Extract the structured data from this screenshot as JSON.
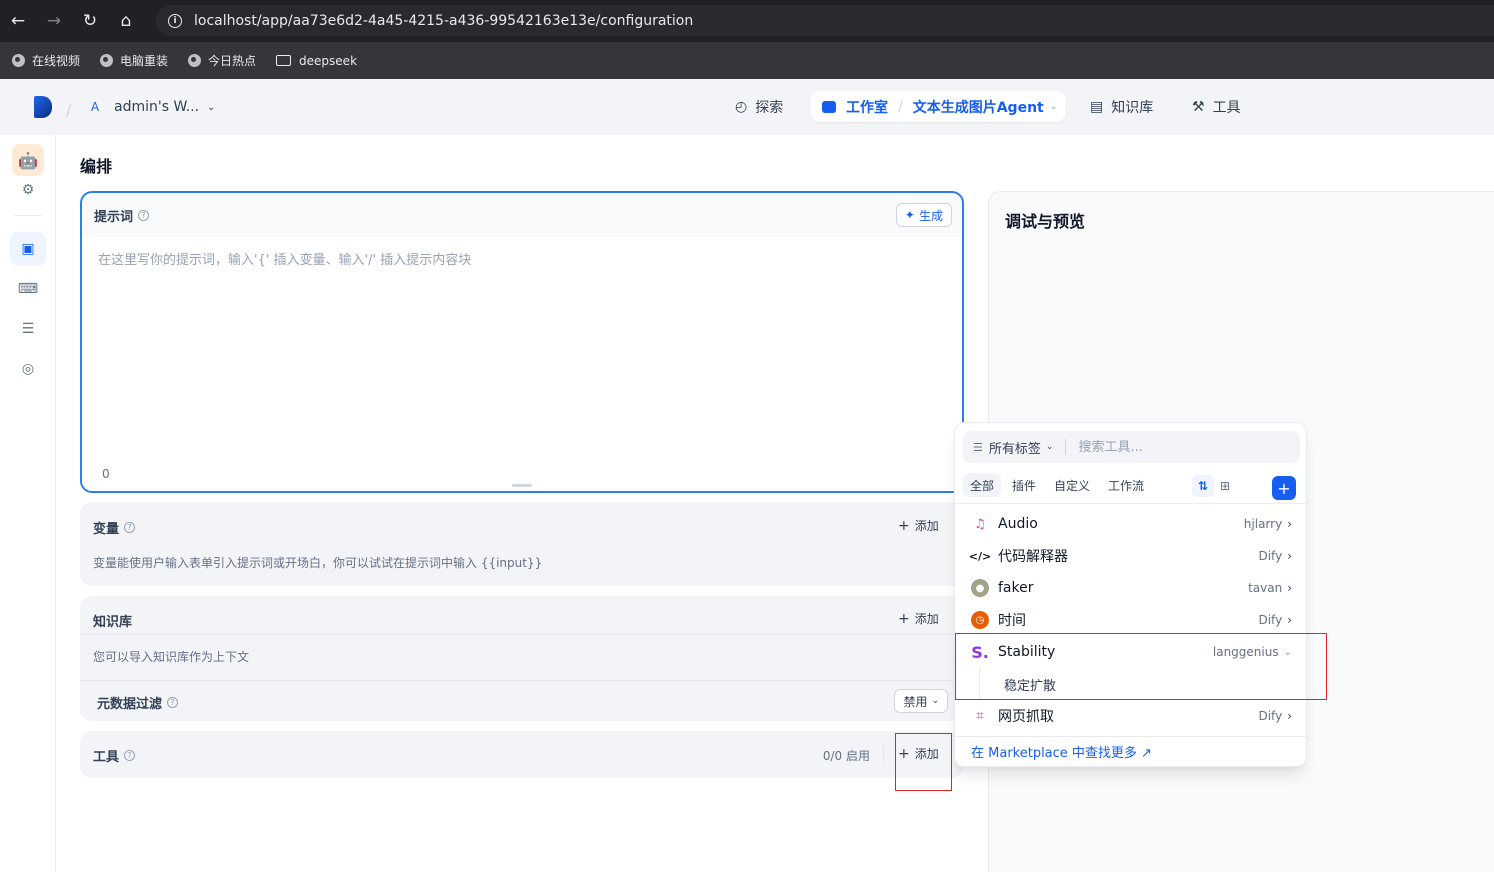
{
  "browser": {
    "url": "localhost/app/aa73e6d2-4a45-4215-a436-99542163e13e/configuration",
    "bookmarks": [
      "在线视频",
      "电脑重装",
      "今日热点",
      "deepseek"
    ]
  },
  "header": {
    "workspace_initial": "A",
    "workspace_name": "admin's W...",
    "nav_explore": "探索",
    "nav_studio": "工作室",
    "current_app": "文本生成图片Agent",
    "nav_knowledge": "知识库",
    "nav_tools": "工具"
  },
  "main": {
    "title": "编排",
    "prompt": {
      "label": "提示词",
      "generate": "生成",
      "placeholder": "在这里写你的提示词，输入'{' 插入变量、输入'/' 插入提示内容块",
      "count": "0"
    },
    "variables": {
      "label": "变量",
      "add": "添加",
      "desc": "变量能使用户输入表单引入提示词或开场白，你可以试试在提示词中输入 {{input}}"
    },
    "knowledge": {
      "label": "知识库",
      "add": "添加",
      "desc": "您可以导入知识库作为上下文",
      "metadata_label": "元数据过滤",
      "metadata_value": "禁用"
    },
    "tools": {
      "label": "工具",
      "count": "0/0 启用",
      "add": "添加"
    }
  },
  "debug": {
    "title": "调试与预览"
  },
  "popover": {
    "tags_label": "所有标签",
    "search_placeholder": "搜索工具...",
    "tabs": [
      "全部",
      "插件",
      "自定义",
      "工作流"
    ],
    "tools": [
      {
        "name": "Audio",
        "author": "hjlarry"
      },
      {
        "name": "代码解释器",
        "author": "Dify"
      },
      {
        "name": "faker",
        "author": "tavan"
      },
      {
        "name": "时间",
        "author": "Dify"
      },
      {
        "name": "Stability",
        "author": "langgenius"
      },
      {
        "name": "网页抓取",
        "author": "Dify"
      }
    ],
    "stability_sub": "稳定扩散",
    "footer": "在 Marketplace 中查找更多 ↗"
  },
  "colors": {
    "accent": "#155eef",
    "highlight": "#e02424"
  }
}
